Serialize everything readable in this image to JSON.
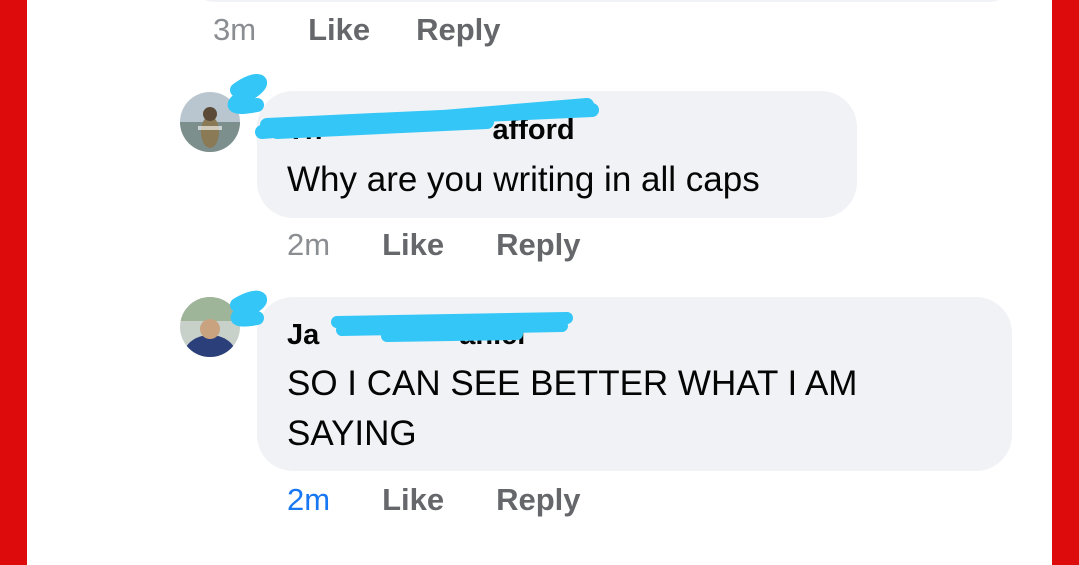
{
  "colors": {
    "frame": "#dd0b0b",
    "bubble": "#f0f2f5",
    "redaction": "#33c6f6",
    "link_time": "#1877f2",
    "action": "#65676b"
  },
  "top_meta": {
    "time": "3m",
    "like": "Like",
    "reply": "Reply"
  },
  "comments": [
    {
      "author_visible_fragment": "Th ... afford",
      "author_shown_start": "Th",
      "author_shown_end": "afford",
      "text": "Why are you writing in all caps",
      "time": "2m",
      "like": "Like",
      "reply": "Reply",
      "avatar_icon": "avatar-photo-icon"
    },
    {
      "author_visible_fragment": "Ja ... aniel",
      "author_shown_start": "Ja",
      "author_shown_end": "aniel",
      "text_line1": "SO I CAN SEE BETTER WHAT I AM",
      "text_line2": "SAYING",
      "time": "2m",
      "like": "Like",
      "reply": "Reply",
      "avatar_icon": "avatar-photo-icon"
    }
  ]
}
